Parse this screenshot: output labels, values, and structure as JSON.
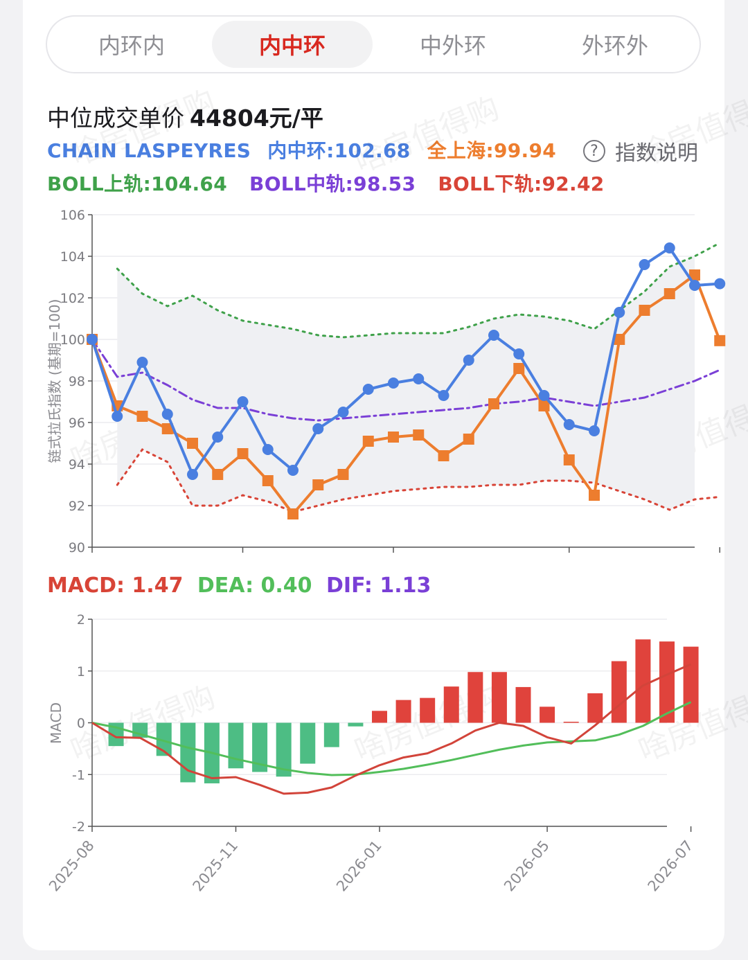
{
  "tabs": [
    "内环内",
    "内中环",
    "中外环",
    "外环外"
  ],
  "active_tab": 1,
  "header": {
    "title": "中位成交单价",
    "price": "44804元/平"
  },
  "legend": {
    "index_name": "CHAIN LASPEYRES",
    "series1": "内中环:102.68",
    "series2": "全上海:99.94",
    "help_label": "指数说明",
    "help_icon": "?",
    "boll_upper": "BOLL上轨:104.64",
    "boll_mid": "BOLL中轨:98.53",
    "boll_lower": "BOLL下轨:92.42"
  },
  "macd_header": {
    "macd": "MACD: 1.47",
    "dea": "DEA: 0.40",
    "dif": "DIF: 1.13"
  },
  "watermark": "啥房值得购",
  "colors": {
    "blue": "#4a7fe0",
    "orange": "#ed7d2e",
    "green": "#3fa14a",
    "purple": "#7a3fd6",
    "red": "#d84437",
    "bar_up": "#e0433c",
    "bar_down": "#4dbd84",
    "dea_line": "#52be5a",
    "dif_line": "#d2443a",
    "band_fill": "#eff0f3"
  },
  "chart_data": [
    {
      "type": "line",
      "ylabel": "链式拉氏指数 (基期=100)",
      "ylim": [
        90,
        106
      ],
      "yticks": [
        90,
        92,
        94,
        96,
        98,
        100,
        102,
        104,
        106
      ],
      "grid": true,
      "x": [
        "2025-08",
        "",
        "",
        "",
        "",
        "2025-11",
        "",
        "",
        "",
        "",
        "",
        "2026-01",
        "",
        "",
        "",
        "",
        "",
        "",
        "2026-05",
        "",
        "",
        "",
        "",
        "",
        "2026-07"
      ],
      "series": [
        {
          "name": "内中环",
          "style": "line-circle",
          "values": [
            100.0,
            96.3,
            98.9,
            96.4,
            93.5,
            95.3,
            97.0,
            94.7,
            93.7,
            95.7,
            96.5,
            97.6,
            97.9,
            98.1,
            97.3,
            99.0,
            100.2,
            99.3,
            97.3,
            95.9,
            95.6,
            101.3,
            103.6,
            104.4,
            102.6,
            102.68
          ]
        },
        {
          "name": "全上海",
          "style": "line-square",
          "values": [
            100.0,
            96.8,
            96.3,
            95.7,
            95.0,
            93.5,
            94.5,
            93.2,
            91.6,
            93.0,
            93.5,
            95.1,
            95.3,
            95.4,
            94.4,
            95.2,
            96.9,
            98.6,
            96.8,
            94.2,
            92.5,
            100.0,
            101.4,
            102.2,
            103.1,
            99.94
          ]
        },
        {
          "name": "BOLL上轨",
          "style": "dotted",
          "values": [
            null,
            103.4,
            102.2,
            101.6,
            102.1,
            101.4,
            100.9,
            100.7,
            100.5,
            100.2,
            100.1,
            100.2,
            100.3,
            100.3,
            100.3,
            100.6,
            101.0,
            101.2,
            101.1,
            100.9,
            100.5,
            101.4,
            102.3,
            103.5,
            104.0,
            104.64
          ]
        },
        {
          "name": "BOLL中轨",
          "style": "dashdot",
          "values": [
            100.0,
            98.2,
            98.4,
            97.8,
            97.1,
            96.7,
            96.7,
            96.4,
            96.2,
            96.1,
            96.2,
            96.3,
            96.4,
            96.5,
            96.6,
            96.7,
            96.9,
            97.0,
            97.2,
            97.0,
            96.8,
            97.0,
            97.2,
            97.6,
            98.0,
            98.53
          ]
        },
        {
          "name": "BOLL下轨",
          "style": "dotted",
          "values": [
            null,
            93.0,
            94.7,
            94.1,
            92.0,
            92.0,
            92.5,
            92.2,
            91.7,
            92.0,
            92.3,
            92.5,
            92.7,
            92.8,
            92.9,
            92.9,
            93.0,
            93.0,
            93.2,
            93.2,
            93.1,
            92.7,
            92.3,
            91.8,
            92.3,
            92.42
          ]
        }
      ]
    },
    {
      "type": "bar",
      "ylabel": "MACD",
      "ylim": [
        -2,
        2
      ],
      "yticks": [
        -2,
        -1,
        0,
        1,
        2
      ],
      "grid": true,
      "x": [
        "2025-08",
        "",
        "",
        "",
        "",
        "2025-11",
        "",
        "",
        "",
        "",
        "",
        "2026-01",
        "",
        "",
        "",
        "",
        "",
        "",
        "2026-05",
        "",
        "",
        "",
        "",
        "",
        "2026-07"
      ],
      "xtick_labels": [
        "2025-08",
        "2025-11",
        "2026-01",
        "2026-05",
        "2026-07"
      ],
      "xtick_index": [
        0,
        6,
        12,
        19,
        25
      ],
      "macd": [
        null,
        -0.45,
        -0.29,
        -0.64,
        -1.15,
        -1.17,
        -0.88,
        -0.95,
        -1.04,
        -0.79,
        -0.47,
        -0.07,
        0.23,
        0.44,
        0.48,
        0.7,
        0.98,
        0.98,
        0.69,
        0.31,
        0.02,
        0.57,
        1.19,
        1.61,
        1.57,
        1.47
      ],
      "dif": [
        0.0,
        -0.28,
        -0.29,
        -0.55,
        -0.92,
        -1.07,
        -1.05,
        -1.2,
        -1.37,
        -1.35,
        -1.25,
        -1.02,
        -0.82,
        -0.67,
        -0.59,
        -0.4,
        -0.15,
        0.0,
        -0.06,
        -0.28,
        -0.4,
        -0.05,
        0.34,
        0.72,
        0.93,
        1.13
      ],
      "dea": [
        0.0,
        -0.09,
        -0.22,
        -0.35,
        -0.48,
        -0.58,
        -0.7,
        -0.8,
        -0.9,
        -0.97,
        -1.01,
        -1.0,
        -0.95,
        -0.89,
        -0.81,
        -0.72,
        -0.62,
        -0.52,
        -0.44,
        -0.38,
        -0.36,
        -0.34,
        -0.23,
        -0.06,
        0.18,
        0.4
      ]
    }
  ]
}
